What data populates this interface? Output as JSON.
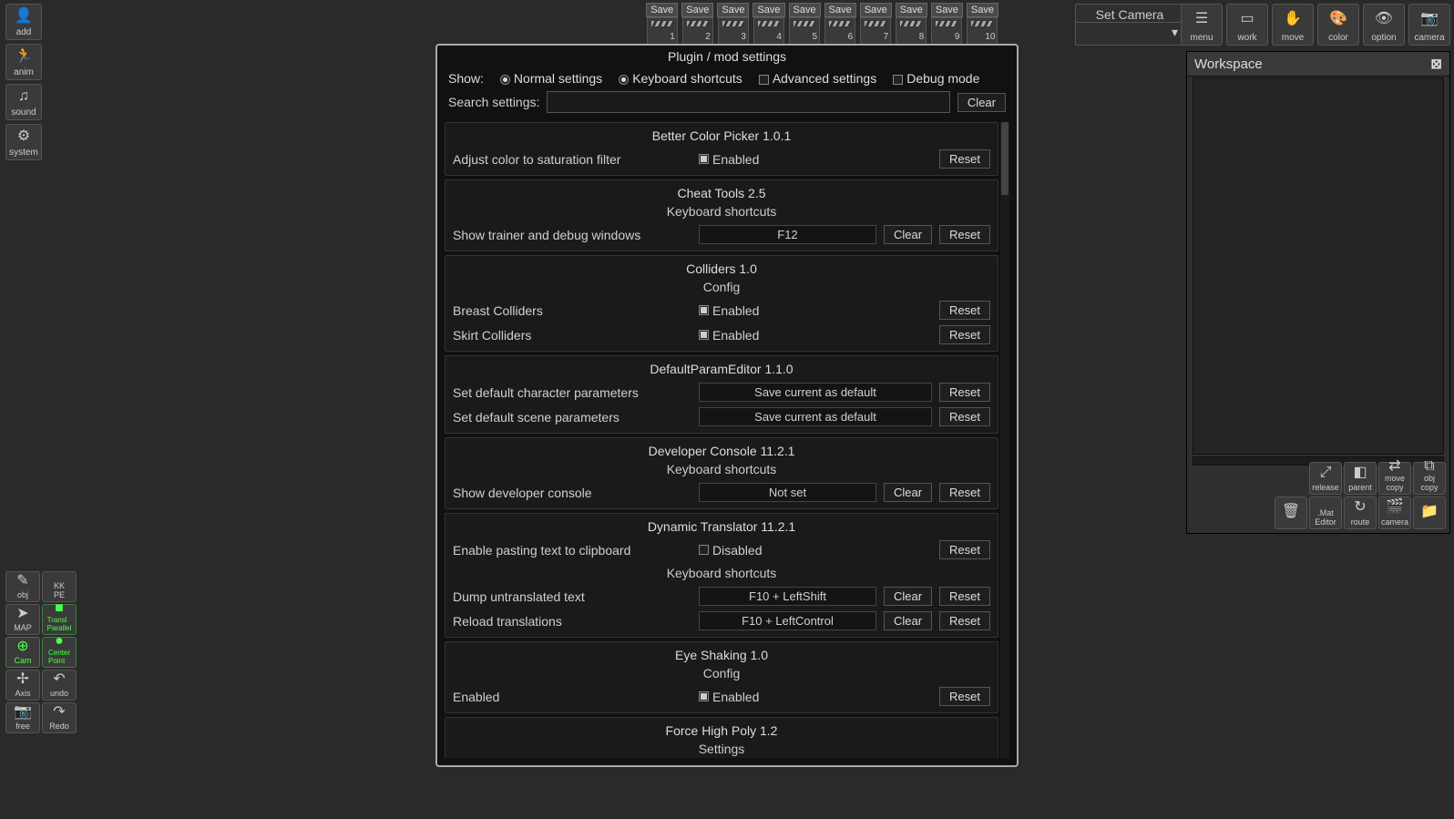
{
  "left_tools": {
    "add": {
      "label": "add"
    },
    "anim": {
      "label": "anim"
    },
    "sound": {
      "label": "sound"
    },
    "system": {
      "label": "system"
    }
  },
  "left_tools2": {
    "obj": "obj",
    "kkpe": "KK\nPE",
    "map": "MAP",
    "transp": "Transl\nParallel",
    "cam": "Cam",
    "center": "Center\nPoint",
    "axis": "Axis",
    "undo": "undo",
    "free": "free",
    "redo": "Redo"
  },
  "save_slots": {
    "save_label": "Save",
    "count": 10
  },
  "set_camera": "Set Camera",
  "top_right": {
    "menu": "menu",
    "work": "work",
    "move": "move",
    "color": "color",
    "option": "option",
    "camera": "camera"
  },
  "workspace": {
    "title": "Workspace",
    "tools": {
      "release": "release",
      "parent": "parent",
      "movecopy": "move\ncopy",
      "objcopy": "obj\ncopy",
      "mat": "Mat.\nEditor",
      "route": "route",
      "camera": "camera",
      "folder": ""
    }
  },
  "modal": {
    "title": "Plugin / mod settings",
    "show_label": "Show:",
    "filters": {
      "normal": "Normal settings",
      "keyboard": "Keyboard shortcuts",
      "advanced": "Advanced settings",
      "debug": "Debug mode"
    },
    "search_label": "Search settings:",
    "search_value": "",
    "clear": "Clear",
    "reset": "Reset",
    "enabled": "Enabled",
    "disabled": "Disabled",
    "notset": "Not set",
    "save_default": "Save current as default",
    "ks": "Keyboard shortcuts",
    "config": "Config",
    "settings_hdr": "Settings",
    "sections": [
      {
        "title": "Better Color Picker 1.0.1",
        "rows": [
          {
            "label": "Adjust color to saturation filter",
            "type": "tog_on"
          }
        ]
      },
      {
        "title": "Cheat Tools 2.5",
        "sub": "ks",
        "rows": [
          {
            "label": "Show trainer and debug windows",
            "type": "key",
            "val": "F12"
          }
        ]
      },
      {
        "title": "Colliders 1.0",
        "sub": "config",
        "rows": [
          {
            "label": "Breast Colliders",
            "type": "tog_on"
          },
          {
            "label": "Skirt Colliders",
            "type": "tog_on"
          }
        ]
      },
      {
        "title": "DefaultParamEditor 1.1.0",
        "rows": [
          {
            "label": "Set default character parameters",
            "type": "act"
          },
          {
            "label": "Set default scene parameters",
            "type": "act"
          }
        ]
      },
      {
        "title": "Developer Console 11.2.1",
        "sub": "ks",
        "rows": [
          {
            "label": "Show developer console",
            "type": "key",
            "val": "notset"
          }
        ]
      },
      {
        "title": "Dynamic Translator 11.2.1",
        "rows": [
          {
            "label": "Enable pasting text to clipboard",
            "type": "tog_off"
          }
        ],
        "sub2": "ks",
        "rows2": [
          {
            "label": "Dump untranslated text",
            "type": "key",
            "val": "F10 + LeftShift"
          },
          {
            "label": "Reload translations",
            "type": "key",
            "val": "F10 + LeftControl"
          }
        ]
      },
      {
        "title": "Eye Shaking 1.0",
        "sub": "config",
        "rows": [
          {
            "label": "Enabled",
            "type": "tog_on"
          }
        ]
      },
      {
        "title": "Force High Poly 1.2",
        "sub": "settings",
        "rows": []
      }
    ]
  }
}
